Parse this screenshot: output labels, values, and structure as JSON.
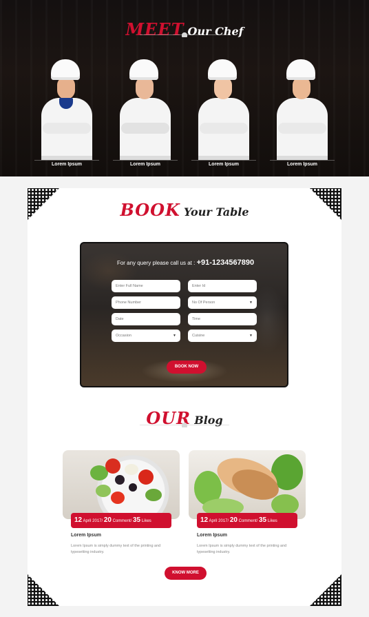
{
  "chef_section": {
    "title_highlight": "MEET",
    "title_rest": "Our Chef",
    "chefs": [
      {
        "name": "Lorem Ipsum"
      },
      {
        "name": "Lorem Ipsum"
      },
      {
        "name": "Lorem Ipsum"
      },
      {
        "name": "Lorem Ipsum"
      }
    ]
  },
  "booking": {
    "title_highlight": "BOOK",
    "title_rest": "Your Table",
    "query_text": "For any query please call us at : ",
    "phone": "+91-1234567890",
    "fields": {
      "full_name": "Enter Full Name",
      "email": "Enter Id",
      "phone": "Phone Number",
      "persons": "No Of Person",
      "date": "Date",
      "time": "Time",
      "occasion": "Occasion",
      "cuisine": "Cuisine"
    },
    "submit_label": "BOOK NOW"
  },
  "blog": {
    "title_highlight": "OUR",
    "title_rest": "Blog",
    "posts": [
      {
        "day": "12",
        "month_year": "April 2017/",
        "comments": "20",
        "comments_label": "Comment/",
        "likes": "35",
        "likes_label": "Likes",
        "title": "Lorem Ipsum",
        "excerpt": "Lorem Ipsum is simply dummy text of the printing and typesetting industry."
      },
      {
        "day": "12",
        "month_year": "April 2017/",
        "comments": "20",
        "comments_label": "Comment/",
        "likes": "35",
        "likes_label": "Likes",
        "title": "Lorem Ipsum",
        "excerpt": "Lorem Ipsum is simply dummy text of the printing and typesetting industry."
      }
    ],
    "more_label": "KNOW MORE"
  },
  "colors": {
    "accent": "#d0102f"
  }
}
